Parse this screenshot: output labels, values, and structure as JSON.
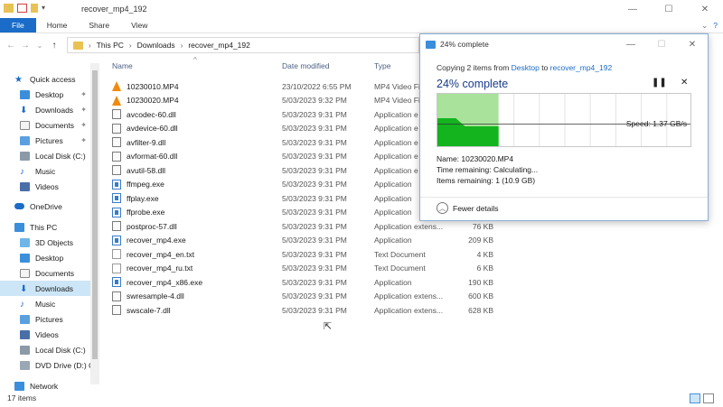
{
  "window": {
    "title": "recover_mp4_192"
  },
  "ribbon": {
    "tabs": [
      "File",
      "Home",
      "Share",
      "View"
    ]
  },
  "breadcrumb": [
    "This PC",
    "Downloads",
    "recover_mp4_192"
  ],
  "sidebar": {
    "items": [
      {
        "label": "Quick access",
        "icon": "star-icon"
      },
      {
        "label": "Desktop",
        "icon": "desktop-icon"
      },
      {
        "label": "Downloads",
        "icon": "download-icon"
      },
      {
        "label": "Documents",
        "icon": "documents-icon"
      },
      {
        "label": "Pictures",
        "icon": "pictures-icon"
      },
      {
        "label": "Local Disk (C:)",
        "icon": "disk-icon"
      },
      {
        "label": "Music",
        "icon": "music-icon"
      },
      {
        "label": "Videos",
        "icon": "videos-icon"
      },
      {
        "label": "OneDrive",
        "icon": "cloud-icon"
      },
      {
        "label": "This PC",
        "icon": "computer-icon"
      },
      {
        "label": "3D Objects",
        "icon": "cube-icon"
      },
      {
        "label": "Desktop",
        "icon": "desktop-icon"
      },
      {
        "label": "Documents",
        "icon": "documents-icon"
      },
      {
        "label": "Downloads",
        "icon": "download-icon"
      },
      {
        "label": "Music",
        "icon": "music-icon"
      },
      {
        "label": "Pictures",
        "icon": "pictures-icon"
      },
      {
        "label": "Videos",
        "icon": "videos-icon"
      },
      {
        "label": "Local Disk (C:)",
        "icon": "disk-icon"
      },
      {
        "label": "DVD Drive (D:) C",
        "icon": "dvd-icon"
      },
      {
        "label": "Network",
        "icon": "network-icon"
      }
    ]
  },
  "columns": {
    "name": "Name",
    "date": "Date modified",
    "type": "Type"
  },
  "files": [
    {
      "name": "10230010.MP4",
      "date": "23/10/2022 6:55 PM",
      "type": "MP4 Video Fi",
      "size": "",
      "kind": "vlc"
    },
    {
      "name": "10230020.MP4",
      "date": "5/03/2023 9:32 PM",
      "type": "MP4 Video Fi",
      "size": "",
      "kind": "vlc"
    },
    {
      "name": "avcodec-60.dll",
      "date": "5/03/2023 9:31 PM",
      "type": "Application e",
      "size": "",
      "kind": "dll"
    },
    {
      "name": "avdevice-60.dll",
      "date": "5/03/2023 9:31 PM",
      "type": "Application e",
      "size": "",
      "kind": "dll"
    },
    {
      "name": "avfilter-9.dll",
      "date": "5/03/2023 9:31 PM",
      "type": "Application e",
      "size": "",
      "kind": "dll"
    },
    {
      "name": "avformat-60.dll",
      "date": "5/03/2023 9:31 PM",
      "type": "Application e",
      "size": "",
      "kind": "dll"
    },
    {
      "name": "avutil-58.dll",
      "date": "5/03/2023 9:31 PM",
      "type": "Application e",
      "size": "",
      "kind": "dll"
    },
    {
      "name": "ffmpeg.exe",
      "date": "5/03/2023 9:31 PM",
      "type": "Application",
      "size": "",
      "kind": "exe"
    },
    {
      "name": "ffplay.exe",
      "date": "5/03/2023 9:31 PM",
      "type": "Application",
      "size": "",
      "kind": "exe"
    },
    {
      "name": "ffprobe.exe",
      "date": "5/03/2023 9:31 PM",
      "type": "Application",
      "size": "",
      "kind": "exe"
    },
    {
      "name": "postproc-57.dll",
      "date": "5/03/2023 9:31 PM",
      "type": "Application extens...",
      "size": "76 KB",
      "kind": "dll"
    },
    {
      "name": "recover_mp4.exe",
      "date": "5/03/2023 9:31 PM",
      "type": "Application",
      "size": "209 KB",
      "kind": "exe"
    },
    {
      "name": "recover_mp4_en.txt",
      "date": "5/03/2023 9:31 PM",
      "type": "Text Document",
      "size": "4 KB",
      "kind": "txt"
    },
    {
      "name": "recover_mp4_ru.txt",
      "date": "5/03/2023 9:31 PM",
      "type": "Text Document",
      "size": "6 KB",
      "kind": "txt"
    },
    {
      "name": "recover_mp4_x86.exe",
      "date": "5/03/2023 9:31 PM",
      "type": "Application",
      "size": "190 KB",
      "kind": "exe"
    },
    {
      "name": "swresample-4.dll",
      "date": "5/03/2023 9:31 PM",
      "type": "Application extens...",
      "size": "600 KB",
      "kind": "dll"
    },
    {
      "name": "swscale-7.dll",
      "date": "5/03/2023 9:31 PM",
      "type": "Application extens...",
      "size": "628 KB",
      "kind": "dll"
    }
  ],
  "status": {
    "count": "17 items"
  },
  "dialog": {
    "title": "24% complete",
    "copy_prefix": "Copying 2 items from ",
    "source": "Desktop",
    "copy_mid": " to ",
    "destination": "recover_mp4_192",
    "percent_text": "24% complete",
    "progress": 0.24,
    "speed": "Speed: 1.37 GB/s",
    "name_line": "Name: 10230020.MP4",
    "time_line": "Time remaining: Calculating...",
    "items_line": "Items remaining: 1 (10.9 GB)",
    "fewer_details": "Fewer details",
    "colors": {
      "graph_light": "#a8e29b",
      "graph_dark": "#13b41e"
    }
  }
}
